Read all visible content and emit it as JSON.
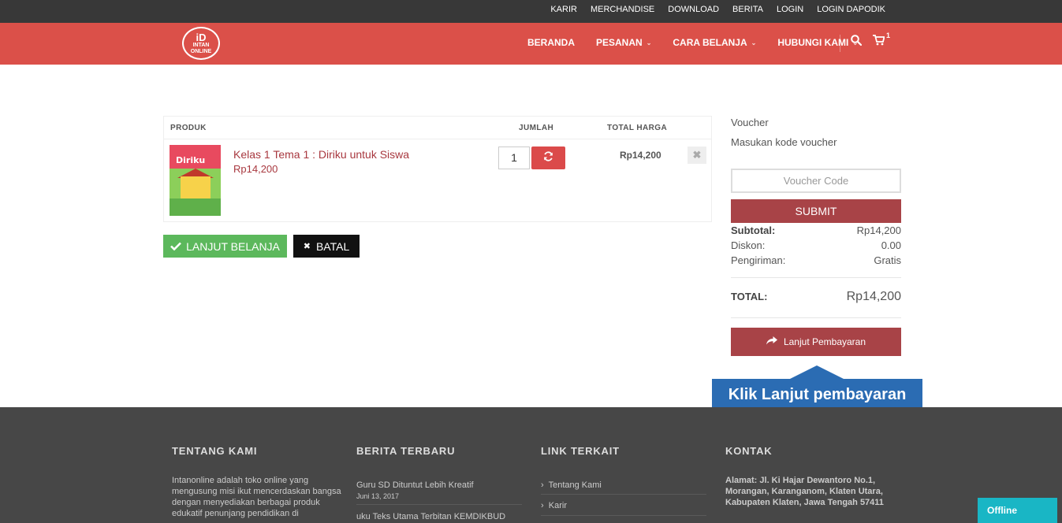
{
  "top_links": [
    "KARIR",
    "MERCHANDISE",
    "DOWNLOAD",
    "BERITA",
    "LOGIN",
    "LOGIN DAPODIK"
  ],
  "brand": {
    "logo_top": "iD",
    "logo_mid": "INTAN",
    "logo_bottom": "ONLINE"
  },
  "menu": [
    {
      "label": "BERANDA",
      "chevron": false
    },
    {
      "label": "PESANAN",
      "chevron": true
    },
    {
      "label": "CARA BELANJA",
      "chevron": true
    },
    {
      "label": "HUBUNGI KAMI",
      "chevron": true
    }
  ],
  "cart_count": "1",
  "table": {
    "col_product": "PRODUK",
    "col_qty": "JUMLAH",
    "col_total": "TOTAL HARGA",
    "item": {
      "cover_title": "Diriku",
      "name": "Kelas 1 Tema 1 : Diriku untuk Siswa",
      "price": "Rp14,200",
      "qty": "1",
      "total": "Rp14,200"
    }
  },
  "buttons": {
    "continue": "LANJUT BELANJA",
    "cancel": "BATAL"
  },
  "voucher": {
    "title": "Voucher",
    "subtitle": "Masukan kode voucher",
    "placeholder": "Voucher Code",
    "submit": "SUBMIT"
  },
  "summary": {
    "subtotal_label": "Subtotal:",
    "subtotal": "Rp14,200",
    "discount_label": "Diskon:",
    "discount": "0.00",
    "shipping_label": "Pengiriman:",
    "shipping": "Gratis",
    "total_label": "TOTAL:",
    "total": "Rp14,200",
    "pay_button": "Lanjut Pembayaran"
  },
  "callout": "Klik Lanjut pembayaran",
  "footer": {
    "about_title": "TENTANG KAMI",
    "about_text": "Intanonline adalah toko online yang mengusung misi ikut mencerdaskan bangsa dengan menyediakan berbagai produk edukatif penunjang pendidikan di",
    "news_title": "BERITA TERBARU",
    "news": [
      {
        "title": "Guru SD Dituntut Lebih Kreatif",
        "date": "Juni 13, 2017"
      },
      {
        "title": "uku Teks Utama Terbitan KEMDIKBUD",
        "date": ""
      }
    ],
    "links_title": "LINK TERKAIT",
    "links": [
      "Tentang Kami",
      "Karir"
    ],
    "contact_title": "KONTAK",
    "contact_text": "Alamat: Jl. Ki Hajar Dewantoro No.1, Morangan, Karanganom, Klaten Utara, Kabupaten Klaten, Jawa Tengah 57411"
  },
  "chat_status": "Offline",
  "colors": {
    "primary": "#db5049",
    "dark_red": "#a84347",
    "green": "#5cb85c",
    "callout": "#2b6cb3",
    "footer": "#474747",
    "chat": "#19b6c5"
  }
}
